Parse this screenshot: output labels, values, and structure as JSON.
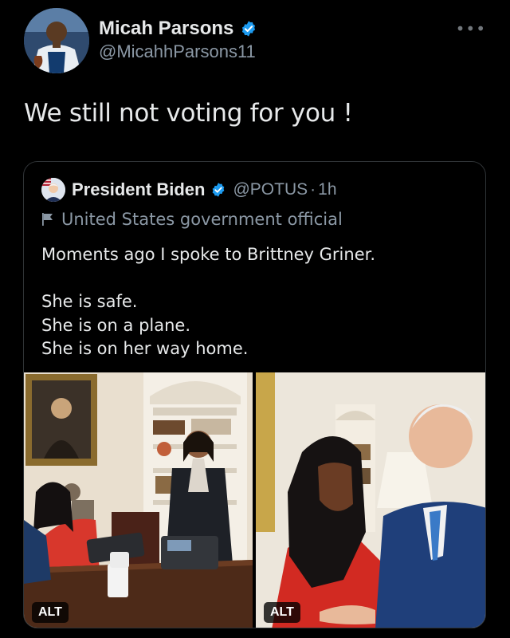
{
  "author": {
    "display_name": "Micah Parsons",
    "handle": "@MicahhParsons11",
    "verified_icon": "verified-badge-icon",
    "avatar_icon": "avatar"
  },
  "more_label": "•••",
  "tweet_text": "We still not voting for you !",
  "quoted": {
    "display_name": "President Biden",
    "handle": "@POTUS",
    "separator": "·",
    "time": "1h",
    "label": "United States government official",
    "text_lines": [
      "Moments ago I spoke to Brittney Griner.",
      "",
      "She is safe.",
      "She is on a plane.",
      "She is on her way home."
    ],
    "media": [
      {
        "alt_label": "ALT"
      },
      {
        "alt_label": "ALT"
      }
    ]
  },
  "colors": {
    "background": "#000000",
    "text": "#e7e9ea",
    "secondary": "#8b98a5",
    "verified": "#1d9bf0",
    "border": "#2f3336"
  }
}
